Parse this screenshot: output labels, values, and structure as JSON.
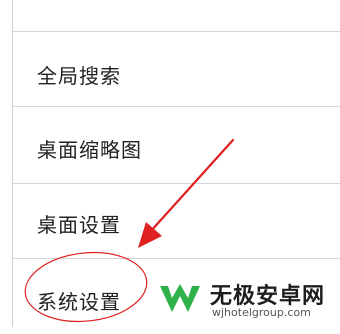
{
  "menu": {
    "items": [
      {
        "label": ""
      },
      {
        "label": "全局搜索"
      },
      {
        "label": "桌面缩略图"
      },
      {
        "label": "桌面设置"
      },
      {
        "label": "系统设置"
      }
    ]
  },
  "annotation": {
    "color": "#e02020",
    "arrow_icon": "arrow-icon",
    "circle_icon": "highlight-circle"
  },
  "watermark": {
    "title": "无极安卓网",
    "url": "wjhotelgroup.com",
    "logo_color": "#2fb24a"
  }
}
